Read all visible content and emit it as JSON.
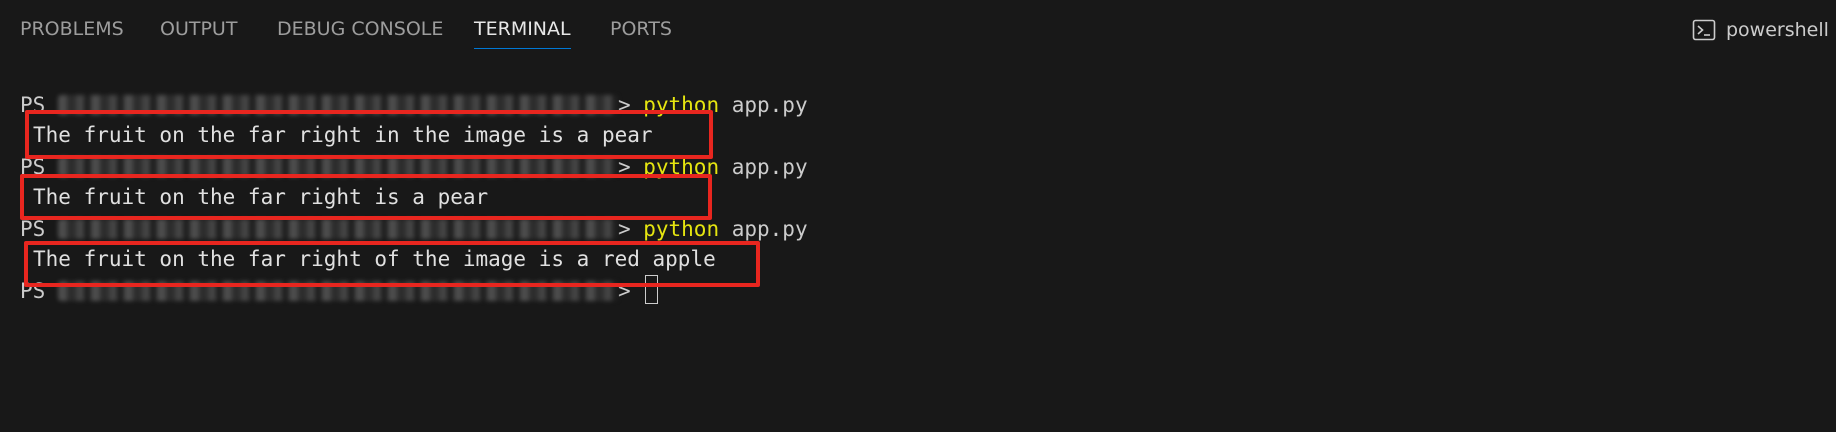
{
  "tabs": [
    {
      "label": "PROBLEMS",
      "active": false
    },
    {
      "label": "OUTPUT",
      "active": false
    },
    {
      "label": "DEBUG CONSOLE",
      "active": false
    },
    {
      "label": "TERMINAL",
      "active": true
    },
    {
      "label": "PORTS",
      "active": false
    }
  ],
  "shell": {
    "icon": "terminal-prompt-icon",
    "label": "powershell"
  },
  "terminal": {
    "prompt_prefix": "PS ",
    "prompt_path": "[blurred path]",
    "prompt_suffix": "> ",
    "command_program": "python",
    "command_args": " app.py",
    "outputs": [
      "The fruit on the far right in the image is a pear",
      "The fruit on the far right is a pear",
      "The fruit on the far right of the image is a red apple"
    ]
  },
  "colors": {
    "background": "#181818",
    "tab_inactive": "#9d9d9d",
    "tab_active": "#e7e7e7",
    "tab_underline": "#0078d4",
    "command_yellow": "#e5e510",
    "highlight_red": "#e8261f"
  }
}
